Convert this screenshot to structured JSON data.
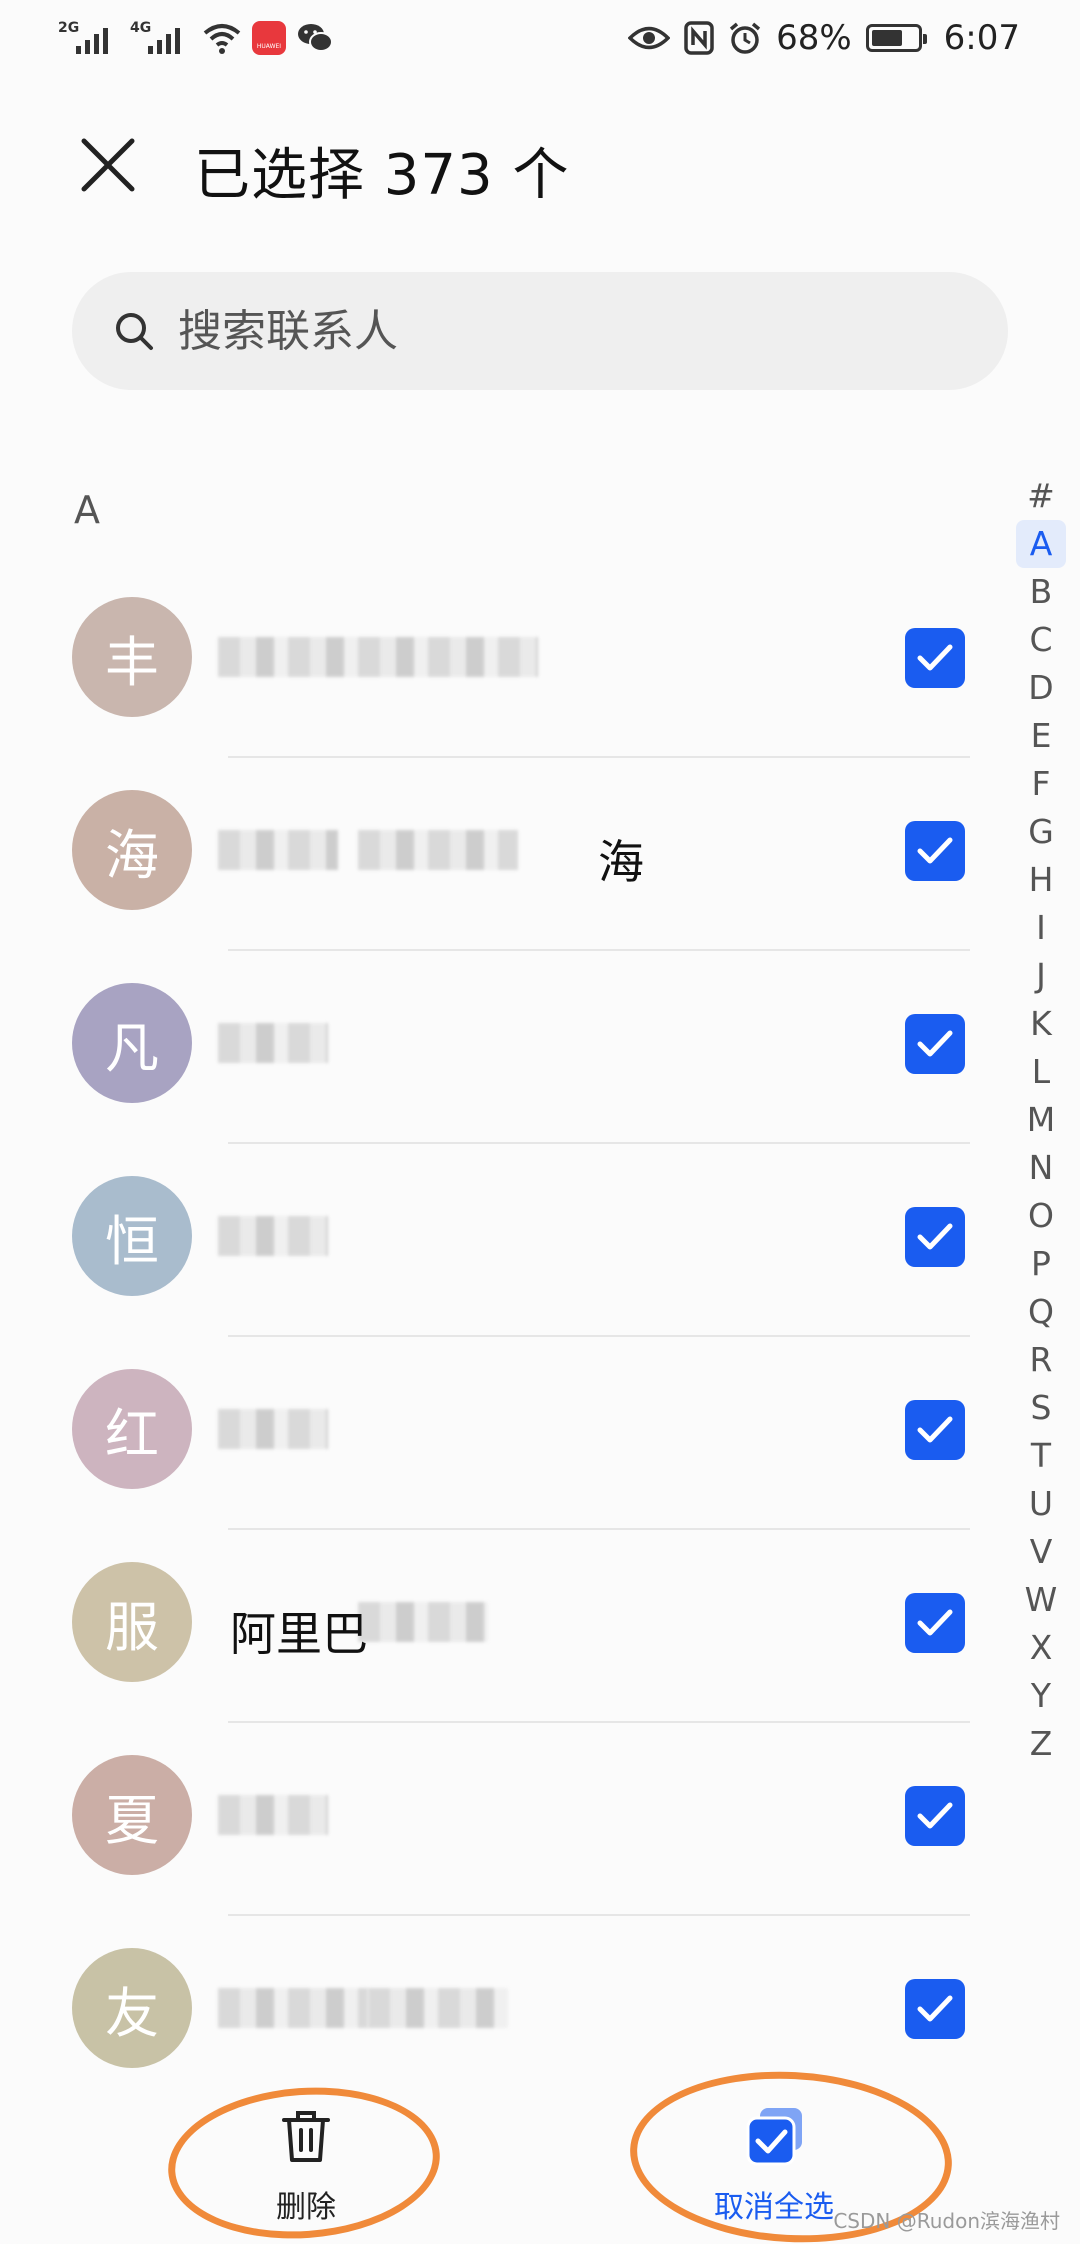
{
  "status_bar": {
    "signal_1": "2G",
    "signal_2": "4G",
    "app_badge": "HUAWEI",
    "battery": "68%",
    "battery_level": 0.68,
    "time": "6:07"
  },
  "header": {
    "title": "已选择 373 个"
  },
  "search": {
    "placeholder": "搜索联系人"
  },
  "section": {
    "letter": "A"
  },
  "contacts": [
    {
      "avatar": "丰",
      "color": "#c9b6ae",
      "name": "",
      "checked": true
    },
    {
      "avatar": "海",
      "color": "#c9b1a6",
      "name": "海",
      "checked": true
    },
    {
      "avatar": "凡",
      "color": "#a8a3c2",
      "name": "",
      "checked": true
    },
    {
      "avatar": "恒",
      "color": "#a9bccd",
      "name": "",
      "checked": true
    },
    {
      "avatar": "红",
      "color": "#cdb4bf",
      "name": "",
      "checked": true
    },
    {
      "avatar": "服",
      "color": "#cdc2a8",
      "name": "阿里巴",
      "checked": true
    },
    {
      "avatar": "夏",
      "color": "#cbaea6",
      "name": "",
      "checked": true
    },
    {
      "avatar": "友",
      "color": "#c8c2a6",
      "name": "",
      "checked": true
    }
  ],
  "index": [
    "#",
    "A",
    "B",
    "C",
    "D",
    "E",
    "F",
    "G",
    "H",
    "I",
    "J",
    "K",
    "L",
    "M",
    "N",
    "O",
    "P",
    "Q",
    "R",
    "S",
    "T",
    "U",
    "V",
    "W",
    "X",
    "Y",
    "Z"
  ],
  "index_active": "A",
  "toolbar": {
    "delete_label": "删除",
    "unselect_label": "取消全选"
  },
  "watermark": "CSDN @Rudon滨海渔村",
  "colors": {
    "accent": "#1a5cf0",
    "annotation": "#f08a3a"
  }
}
